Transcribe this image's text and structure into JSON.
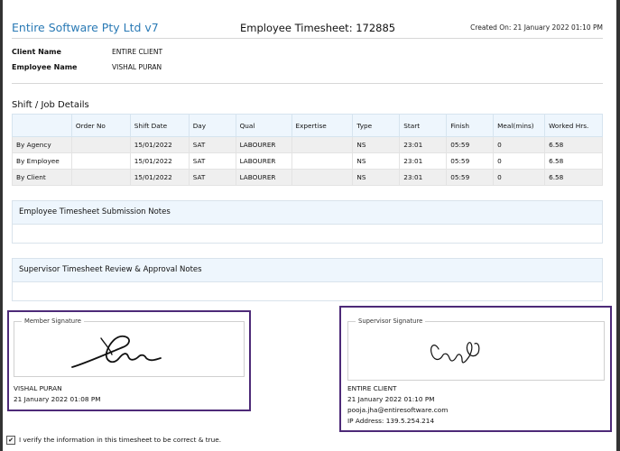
{
  "header": {
    "company": "Entire Software Pty Ltd v7",
    "title": "Employee Timesheet: 172885",
    "created": "Created On: 21 January 2022 01:10 PM"
  },
  "info": {
    "client_label": "Client Name",
    "client_value": "ENTIRE CLIENT",
    "employee_label": "Employee Name",
    "employee_value": "VISHAL PURAN"
  },
  "shift": {
    "title": "Shift / Job Details",
    "columns": [
      "",
      "Order No",
      "Shift Date",
      "Day",
      "Qual",
      "Expertise",
      "Type",
      "Start",
      "Finish",
      "Meal(mins)",
      "Worked Hrs."
    ],
    "rows": [
      [
        "By Agency",
        "",
        "15/01/2022",
        "SAT",
        "LABOURER",
        "",
        "NS",
        "23:01",
        "05:59",
        "0",
        "6.58"
      ],
      [
        "By Employee",
        "",
        "15/01/2022",
        "SAT",
        "LABOURER",
        "",
        "NS",
        "23:01",
        "05:59",
        "0",
        "6.58"
      ],
      [
        "By Client",
        "",
        "15/01/2022",
        "SAT",
        "LABOURER",
        "",
        "NS",
        "23:01",
        "05:59",
        "0",
        "6.58"
      ]
    ]
  },
  "notes": {
    "submission_title": "Employee Timesheet Submission Notes",
    "review_title": "Supervisor Timesheet Review & Approval Notes"
  },
  "member_sig": {
    "legend": "Member Signature",
    "name": "VISHAL PURAN",
    "date": "21 January 2022 01:08 PM"
  },
  "supervisor_sig": {
    "legend": "Supervisor Signature",
    "name": "ENTIRE CLIENT",
    "date": "21 January 2022 01:10 PM",
    "email": "pooja.jha@entiresoftware.com",
    "ip": "IP Address: 139.5.254.214"
  },
  "verify": {
    "checkmark": "✔",
    "label": "I verify the information in this timesheet to be correct & true."
  },
  "colors": {
    "brand": "#2a7ab5",
    "highlight_border": "#4d2a78",
    "header_bg": "#eef6fd"
  }
}
